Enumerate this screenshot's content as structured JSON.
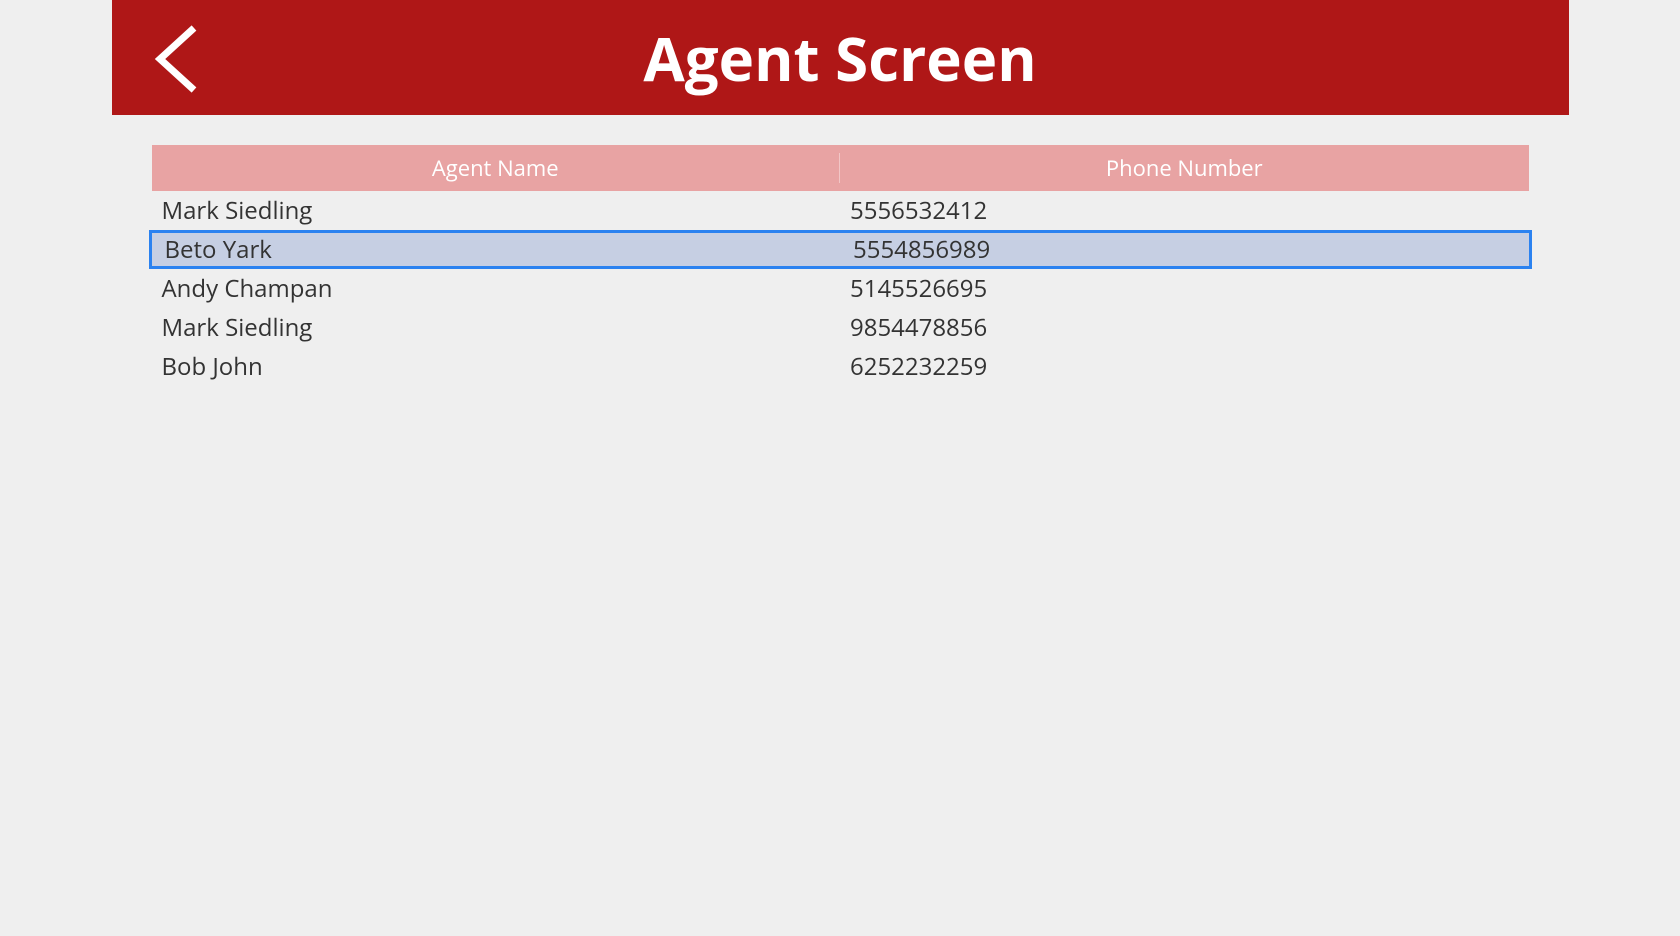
{
  "header": {
    "title": "Agent Screen"
  },
  "columns": {
    "name": "Agent Name",
    "phone": "Phone Number"
  },
  "rows": [
    {
      "name": "Mark Siedling",
      "phone": "5556532412",
      "selected": false
    },
    {
      "name": "Beto Yark",
      "phone": "5554856989",
      "selected": true
    },
    {
      "name": "Andy Champan",
      "phone": "5145526695",
      "selected": false
    },
    {
      "name": "Mark Siedling",
      "phone": "9854478856",
      "selected": false
    },
    {
      "name": "Bob John",
      "phone": "6252232259",
      "selected": false
    }
  ],
  "colors": {
    "header_bg": "#af1717",
    "col_header_bg": "#e8a3a3",
    "selected_border": "#2b82f0",
    "selected_bg": "#c6cfe3",
    "page_bg": "#efefef"
  }
}
